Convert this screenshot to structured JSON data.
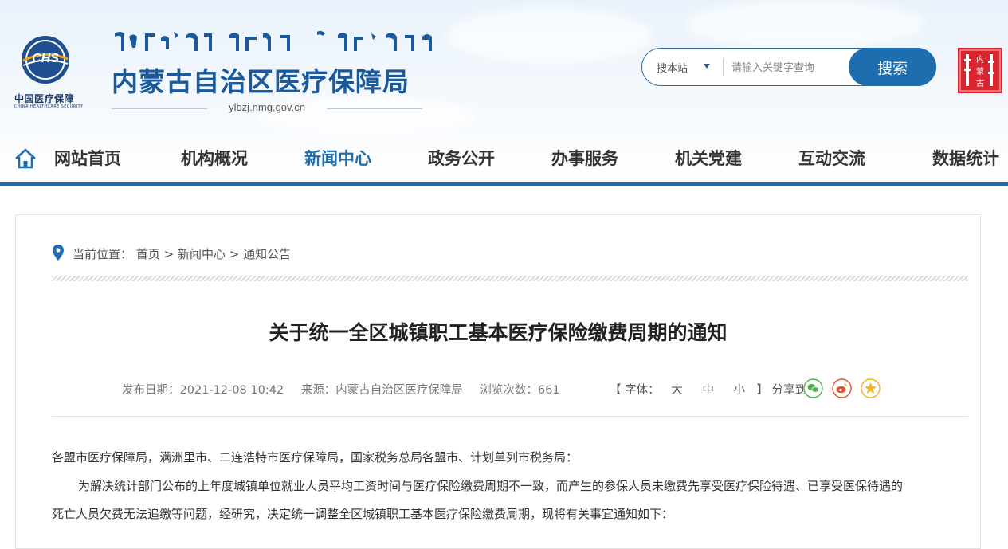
{
  "header": {
    "logo_cn": "中国医疗保障",
    "logo_en": "CHINA HEALTHCARE SECURITY",
    "logo_mark": "CHS",
    "site_title": "内蒙古自治区医疗保障局",
    "site_url": "ylbzj.nmg.gov.cn",
    "seal_text": "内蒙古"
  },
  "search": {
    "scope_label": "搜本站",
    "placeholder": "请输入关键字查询",
    "button_label": "搜索"
  },
  "nav": {
    "items": [
      {
        "label": "网站首页",
        "active": false
      },
      {
        "label": "机构概况",
        "active": false
      },
      {
        "label": "新闻中心",
        "active": true
      },
      {
        "label": "政务公开",
        "active": false
      },
      {
        "label": "办事服务",
        "active": false
      },
      {
        "label": "机关党建",
        "active": false
      },
      {
        "label": "互动交流",
        "active": false
      },
      {
        "label": "数据统计",
        "active": false
      }
    ]
  },
  "breadcrumb": {
    "prefix": "当前位置：",
    "items": [
      "首页",
      "新闻中心",
      "通知公告"
    ],
    "separator": ">"
  },
  "article": {
    "title": "关于统一全区城镇职工基本医疗保险缴费周期的通知",
    "publish_date": "发布日期：2021-12-08 10:42",
    "source": "来源：内蒙古自治区医疗保障局",
    "views": "浏览次数：661",
    "font_label": "【 字体：",
    "font_sizes": [
      "大",
      "中",
      "小"
    ],
    "font_close": "】",
    "share_label": "分享到：",
    "share_icons": [
      "wechat-icon",
      "weibo-icon",
      "qzone-icon"
    ],
    "paragraphs": [
      "各盟市医疗保障局，满洲里市、二连浩特市医疗保障局，国家税务总局各盟市、计划单列市税务局：",
      "为解决统计部门公布的上年度城镇单位就业人员平均工资时间与医疗保险缴费周期不一致，而产生的参保人员未缴费先享受医疗保险待遇、已享受医保待遇的",
      "死亡人员欠费无法追缴等问题，经研究，决定统一调整全区城镇职工基本医疗保险缴费周期，现将有关事宜通知如下："
    ]
  },
  "colors": {
    "brand_blue": "#1e6eaf",
    "nav_active": "#1e6eaf",
    "seal_red": "#d9252f",
    "wechat": "#4caf50",
    "weibo": "#e0562c",
    "qzone": "#f3b31b"
  }
}
